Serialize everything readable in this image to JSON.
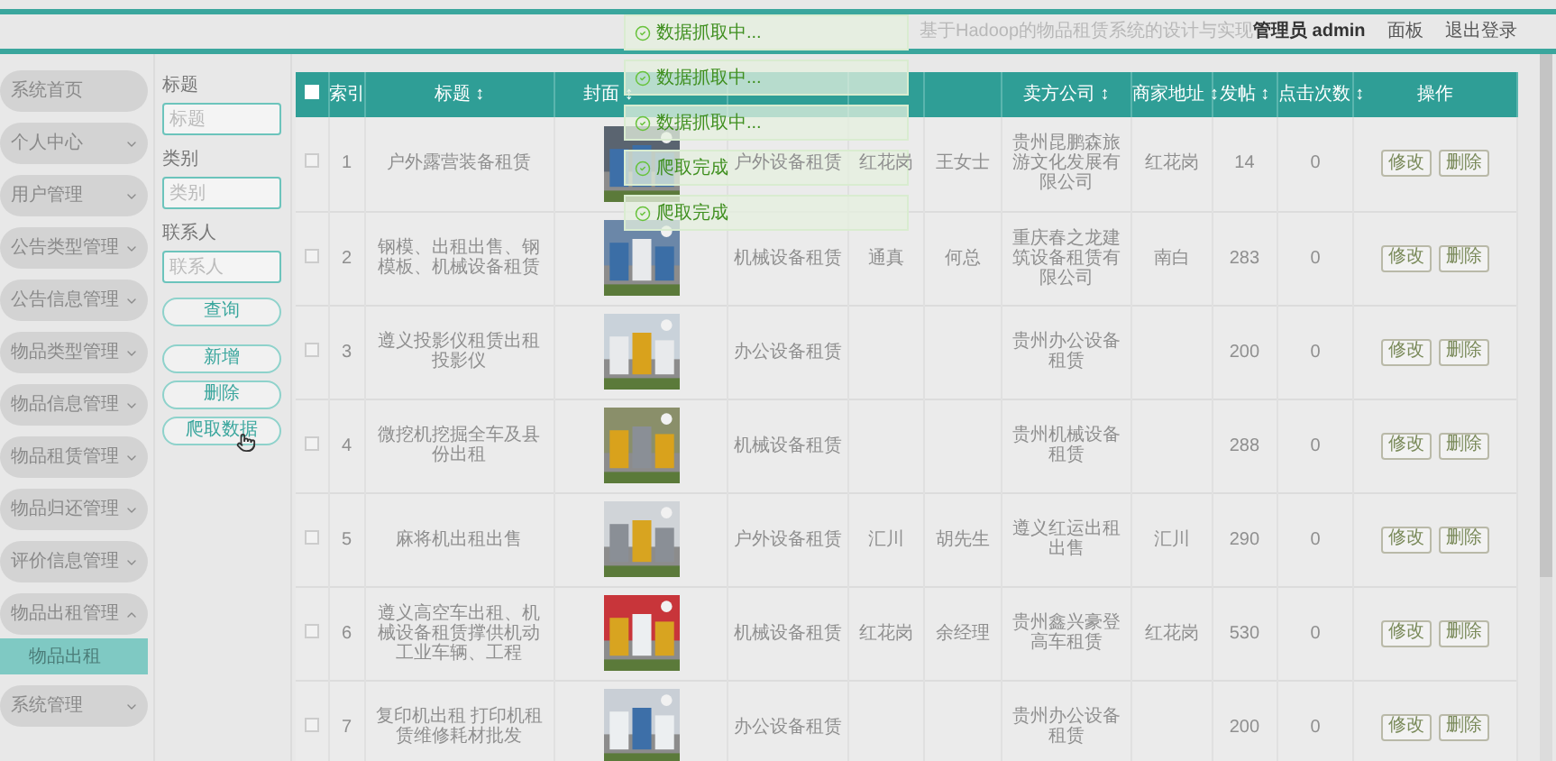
{
  "header": {
    "title": "基于Hadoop的物品租赁系统的设计与实现",
    "user": "管理员 admin",
    "links": [
      "面板",
      "退出登录"
    ]
  },
  "toasts": [
    {
      "text": "数据抓取中...",
      "kind": "success"
    },
    {
      "text": "数据抓取中...",
      "kind": "success"
    },
    {
      "text": "数据抓取中...",
      "kind": "success"
    },
    {
      "text": "爬取完成",
      "kind": "success"
    },
    {
      "text": "爬取完成",
      "kind": "success"
    }
  ],
  "sidebar": {
    "items": [
      {
        "label": "系统首页",
        "kind": "link"
      },
      {
        "label": "个人中心",
        "kind": "group",
        "expanded": false
      },
      {
        "label": "用户管理",
        "kind": "group",
        "expanded": false
      },
      {
        "label": "公告类型管理",
        "kind": "group",
        "expanded": false
      },
      {
        "label": "公告信息管理",
        "kind": "group",
        "expanded": false
      },
      {
        "label": "物品类型管理",
        "kind": "group",
        "expanded": false
      },
      {
        "label": "物品信息管理",
        "kind": "group",
        "expanded": false
      },
      {
        "label": "物品租赁管理",
        "kind": "group",
        "expanded": false
      },
      {
        "label": "物品归还管理",
        "kind": "group",
        "expanded": false
      },
      {
        "label": "评价信息管理",
        "kind": "group",
        "expanded": false
      },
      {
        "label": "物品出租管理",
        "kind": "group",
        "expanded": true,
        "children": [
          {
            "label": "物品出租",
            "selected": true
          }
        ]
      },
      {
        "label": "系统管理",
        "kind": "group",
        "expanded": false
      }
    ]
  },
  "search": {
    "fields": [
      {
        "label": "标题",
        "placeholder": "标题"
      },
      {
        "label": "类别",
        "placeholder": "类别"
      },
      {
        "label": "联系人",
        "placeholder": "联系人"
      }
    ],
    "buttons": [
      "查询",
      "新增",
      "删除",
      "爬取数据"
    ]
  },
  "table": {
    "select_all": {
      "checked": false
    },
    "columns": [
      "索引",
      "标题 ↕",
      "封面 ↕",
      "",
      "",
      "",
      "卖方公司 ↕",
      "商家地址 ↕",
      "发帖 ↕",
      "点击次数 ↕",
      "操作"
    ],
    "rows": [
      {
        "selected": false,
        "cells": [
          "1",
          "户外露营装备租赁",
          {
            "kind": "picture"
          },
          "户外设备租赁",
          "红花岗",
          "王女士",
          "贵州昆鹏森旅游文化发展有限公司",
          "红花岗",
          "14",
          "0",
          [
            "修改",
            "删除"
          ]
        ]
      },
      {
        "selected": false,
        "cells": [
          "2",
          "钢模、出租出售、钢模板、机械设备租赁",
          {
            "kind": "picture"
          },
          "机械设备租赁",
          "通真",
          "何总",
          "重庆春之龙建筑设备租赁有限公司",
          "南白",
          "283",
          "0",
          [
            "修改",
            "删除"
          ]
        ]
      },
      {
        "selected": false,
        "cells": [
          "3",
          "遵义投影仪租赁出租投影仪",
          {
            "kind": "picture"
          },
          "办公设备租赁",
          "",
          "",
          "贵州办公设备租赁",
          "",
          "200",
          "0",
          [
            "修改",
            "删除"
          ]
        ]
      },
      {
        "selected": false,
        "cells": [
          "4",
          "微挖机挖掘全车及县份出租",
          {
            "kind": "picture"
          },
          "机械设备租赁",
          "",
          "",
          "贵州机械设备租赁",
          "",
          "288",
          "0",
          [
            "修改",
            "删除"
          ]
        ]
      },
      {
        "selected": false,
        "cells": [
          "5",
          "麻将机出租出售",
          {
            "kind": "picture"
          },
          "户外设备租赁",
          "汇川",
          "胡先生",
          "遵义红运出租出售",
          "汇川",
          "290",
          "0",
          [
            "修改",
            "删除"
          ]
        ]
      },
      {
        "selected": false,
        "cells": [
          "6",
          "遵义高空车出租、机械设备租赁撑供机动工业车辆、工程",
          {
            "kind": "picture"
          },
          "机械设备租赁",
          "红花岗",
          "余经理",
          "贵州鑫兴豪登高车租赁",
          "红花岗",
          "530",
          "0",
          [
            "修改",
            "删除"
          ]
        ]
      },
      {
        "selected": false,
        "cells": [
          "7",
          "复印机出租 打印机租赁维修耗材批发",
          {
            "kind": "picture"
          },
          "办公设备租赁",
          "",
          "",
          "贵州办公设备租赁",
          "",
          "200",
          "0",
          [
            "修改",
            "删除"
          ]
        ]
      }
    ]
  }
}
